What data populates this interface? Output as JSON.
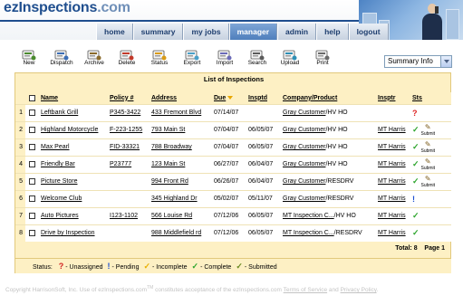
{
  "app": {
    "logo_main": "ezInspections",
    "logo_dot": ".com"
  },
  "nav": {
    "items": [
      {
        "label": "home"
      },
      {
        "label": "summary"
      },
      {
        "label": "my jobs"
      },
      {
        "label": "manager",
        "active": true
      },
      {
        "label": "admin"
      },
      {
        "label": "help"
      },
      {
        "label": "logout"
      }
    ]
  },
  "toolbar": {
    "items": [
      {
        "label": "New",
        "icon": "new-inspection-icon"
      },
      {
        "label": "Dispatch",
        "icon": "dispatch-icon"
      },
      {
        "label": "Archive",
        "icon": "archive-icon"
      },
      {
        "label": "Delete",
        "icon": "delete-icon"
      },
      {
        "label": "Status",
        "icon": "status-icon"
      },
      {
        "label": "Export",
        "icon": "export-icon"
      },
      {
        "label": "Import",
        "icon": "import-icon"
      },
      {
        "label": "Search",
        "icon": "search-icon"
      },
      {
        "label": "Upload",
        "icon": "upload-icon"
      },
      {
        "label": "Print",
        "icon": "print-icon"
      }
    ]
  },
  "view_select": {
    "value": "Summary Info"
  },
  "panel": {
    "title": "List of Inspections"
  },
  "table": {
    "headers": {
      "name": "Name",
      "policy": "Policy #",
      "address": "Address",
      "due": "Due",
      "inspd": "Insptd",
      "company": "Company/Product",
      "inspector": "Insptr",
      "status": "Sts"
    },
    "rows": [
      {
        "num": "1",
        "name": "Leftbank Grill",
        "policy": "P345-3422",
        "address": "433 Fremont Blvd",
        "due": "07/14/07",
        "inspd": "",
        "company": "Gray Customer",
        "product": "/HV HO",
        "inspector": "",
        "status": "unassigned",
        "submit": false
      },
      {
        "num": "2",
        "name": "Highland Motorcycle",
        "policy": "F-223-1255",
        "address": "793 Main St",
        "due": "07/04/07",
        "inspd": "06/05/07",
        "company": "Gray Customer",
        "product": "/HV HO",
        "inspector": "MT Harris",
        "status": "complete",
        "submit": true
      },
      {
        "num": "3",
        "name": "Max Pearl",
        "policy": "FID-33321",
        "address": "788 Broadway",
        "due": "07/04/07",
        "inspd": "06/05/07",
        "company": "Gray Customer",
        "product": "/HV HO",
        "inspector": "MT Harris",
        "status": "complete",
        "submit": true
      },
      {
        "num": "4",
        "name": "Friendly Bar",
        "policy": "P23777",
        "address": "123 Main St",
        "due": "06/27/07",
        "inspd": "06/04/07",
        "company": "Gray Customer",
        "product": "/HV HO",
        "inspector": "MT Harris",
        "status": "complete",
        "submit": true
      },
      {
        "num": "5",
        "name": "Picture Store",
        "policy": "",
        "address": "994 Front Rd",
        "due": "06/26/07",
        "inspd": "06/04/07",
        "company": "Gray Customer",
        "product": "/RESDRV",
        "inspector": "MT Harris",
        "status": "complete",
        "submit": true
      },
      {
        "num": "6",
        "name": "Welcome Club",
        "policy": "",
        "address": "345 Highland Dr",
        "due": "05/02/07",
        "inspd": "05/11/07",
        "company": "Gray Customer",
        "product": "/RESDRV",
        "inspector": "MT Harris",
        "status": "pending",
        "submit": false
      },
      {
        "num": "7",
        "name": "Auto Pictures",
        "policy": "I123-1102",
        "address": "566 Louise Rd",
        "due": "07/12/06",
        "inspd": "06/05/07",
        "company": "MT Inspection C...",
        "product": "/HV HO",
        "inspector": "MT Harris",
        "status": "complete",
        "submit": false
      },
      {
        "num": "8",
        "name": "Drive by Inspection",
        "policy": "",
        "address": "988 Middlefield rd",
        "due": "07/12/06",
        "inspd": "06/05/07",
        "company": "MT Inspection C...",
        "product": "/RESDRV",
        "inspector": "MT Harris",
        "status": "complete",
        "submit": false
      }
    ],
    "submit_label": "Submit"
  },
  "totals": {
    "total_label": "Total:",
    "total_value": "8",
    "page_label": "Page",
    "page_value": "1"
  },
  "status_legend": {
    "label": "Status:",
    "items": [
      {
        "symbol": "?",
        "text": "- Unassigned",
        "color": "#d22222"
      },
      {
        "symbol": "!",
        "text": "- Pending",
        "color": "#1c4fd1"
      },
      {
        "symbol": "✓",
        "text": "- Incomplete",
        "color": "#e8b000"
      },
      {
        "symbol": "✓",
        "text": "- Complete",
        "color": "#2ea52e"
      },
      {
        "symbol": "✓",
        "text": "- Submitted",
        "color": "#6a8a20"
      }
    ]
  },
  "footer": {
    "text_before": "Copyright HarrisonSoft, Inc. Use of ezInspections.com",
    "tm": "TM",
    "text_after": "constitutes acceptance of the ezInspections.com",
    "terms_link": "Terms of Service",
    "and": "and",
    "privacy_link": "Privacy Policy",
    "period": "."
  }
}
